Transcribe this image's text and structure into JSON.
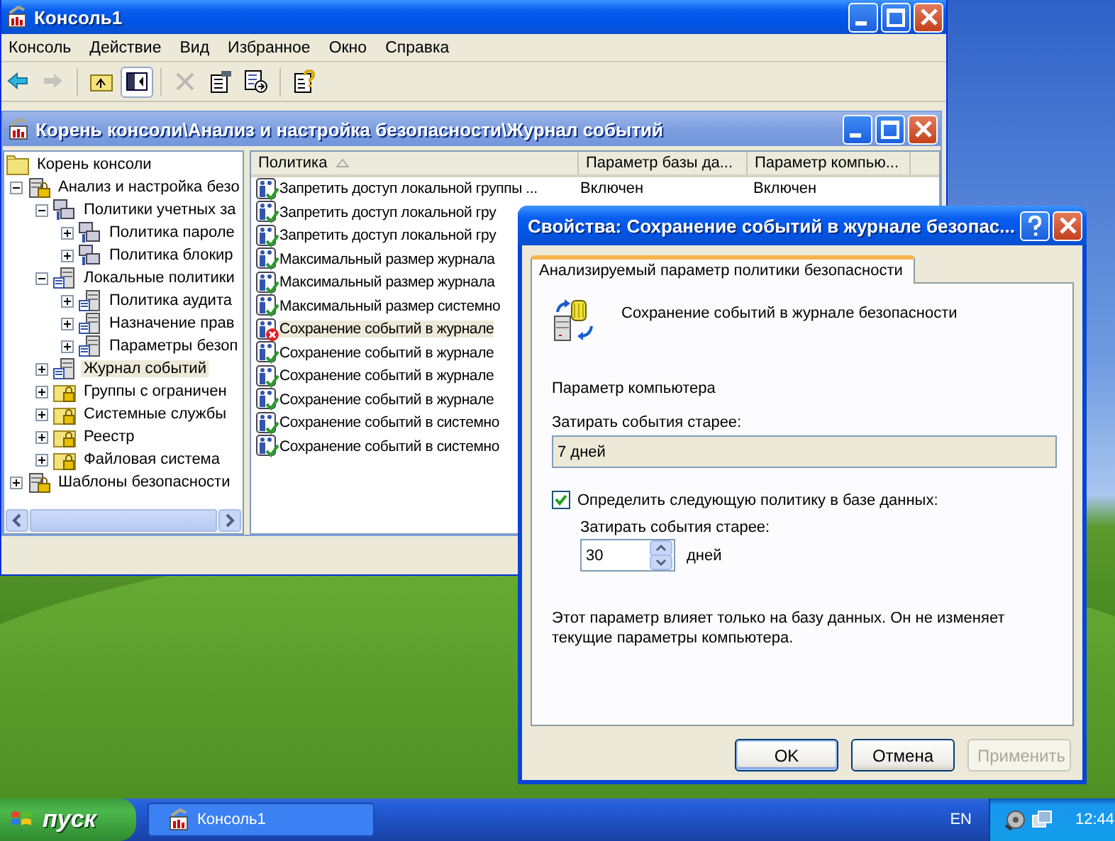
{
  "main_window": {
    "title": "Консоль1",
    "menu": [
      "Консоль",
      "Действие",
      "Вид",
      "Избранное",
      "Окно",
      "Справка"
    ],
    "toolbar": [
      {
        "kind": "back",
        "disabled": false
      },
      {
        "kind": "forward",
        "disabled": true
      },
      {
        "kind": "sep"
      },
      {
        "kind": "up",
        "disabled": false
      },
      {
        "kind": "tree",
        "disabled": false,
        "pressed": true
      },
      {
        "kind": "sep"
      },
      {
        "kind": "delete",
        "disabled": true
      },
      {
        "kind": "properties",
        "disabled": false
      },
      {
        "kind": "export",
        "disabled": false
      },
      {
        "kind": "sep"
      },
      {
        "kind": "help",
        "disabled": false
      }
    ]
  },
  "child_window": {
    "title": "Корень консоли\\Анализ и настройка безопасности\\Журнал событий",
    "tree": [
      {
        "label": "Корень консоли",
        "kind": "folder",
        "selected": false,
        "children": [
          {
            "label": "Анализ и настройка безо",
            "kind": "secure",
            "expanded": true,
            "selected": false,
            "children": [
              {
                "label": "Политики учетных за",
                "kind": "accounts",
                "expanded": true,
                "selected": false,
                "children": [
                  {
                    "label": "Политика пароле",
                    "kind": "accounts",
                    "expanded": false,
                    "selected": false
                  },
                  {
                    "label": "Политика блокир",
                    "kind": "accounts",
                    "expanded": false,
                    "selected": false
                  }
                ]
              },
              {
                "label": "Локальные политики",
                "kind": "local",
                "expanded": true,
                "selected": false,
                "children": [
                  {
                    "label": "Политика аудита",
                    "kind": "local",
                    "expanded": false,
                    "selected": false
                  },
                  {
                    "label": "Назначение прав",
                    "kind": "local",
                    "expanded": false,
                    "selected": false
                  },
                  {
                    "label": "Параметры безоп",
                    "kind": "local",
                    "expanded": false,
                    "selected": false
                  }
                ]
              },
              {
                "label": "Журнал событий",
                "kind": "local",
                "expanded": false,
                "selected": true
              },
              {
                "label": "Группы с ограничен",
                "kind": "lockfolder",
                "expanded": false,
                "selected": false
              },
              {
                "label": "Системные службы",
                "kind": "lockfolder",
                "expanded": false,
                "selected": false
              },
              {
                "label": "Реестр",
                "kind": "lockfolder",
                "expanded": false,
                "selected": false
              },
              {
                "label": "Файловая система",
                "kind": "lockfolder",
                "expanded": false,
                "selected": false
              }
            ]
          },
          {
            "label": "Шаблоны безопасности",
            "kind": "secure",
            "expanded": false,
            "selected": false
          }
        ]
      }
    ],
    "list": {
      "columns": [
        {
          "label": "Политика",
          "sorted": true
        },
        {
          "label": "Параметр базы да...",
          "sorted": false
        },
        {
          "label": "Параметр компью...",
          "sorted": false
        }
      ],
      "rows": [
        {
          "policy": "Запретить доступ локальной группы ...",
          "database": "Включен",
          "computer": "Включен",
          "mismatch": false,
          "selected": false
        },
        {
          "policy": "Запретить доступ локальной гру",
          "mismatch": false,
          "selected": false
        },
        {
          "policy": "Запретить доступ локальной гру",
          "mismatch": false,
          "selected": false
        },
        {
          "policy": "Максимальный размер журнала",
          "mismatch": false,
          "selected": false
        },
        {
          "policy": "Максимальный размер журнала",
          "mismatch": false,
          "selected": false
        },
        {
          "policy": "Максимальный размер системно",
          "mismatch": false,
          "selected": false
        },
        {
          "policy": "Сохранение событий в журнале",
          "mismatch": true,
          "selected": true
        },
        {
          "policy": "Сохранение событий в журнале",
          "mismatch": false,
          "selected": false
        },
        {
          "policy": "Сохранение событий в журнале",
          "mismatch": false,
          "selected": false
        },
        {
          "policy": "Сохранение событий в журнале",
          "mismatch": false,
          "selected": false
        },
        {
          "policy": "Сохранение событий в системно",
          "mismatch": false,
          "selected": false
        },
        {
          "policy": "Сохранение событий в системно",
          "mismatch": false,
          "selected": false
        }
      ]
    }
  },
  "dialog": {
    "title": "Свойства: Сохранение событий в журнале безопас...",
    "tabs": [
      {
        "label": "Анализируемый параметр политики безопасности",
        "selected": true
      }
    ],
    "heading": "Сохранение событий в журнале безопасности",
    "section": "Параметр компьютера",
    "computer_label": "Затирать события старее:",
    "computer_value": "7 дней",
    "checkbox": {
      "label": "Определить следующую политику в базе данных:",
      "checked": true
    },
    "database_label": "Затирать события старее:",
    "spinner": {
      "value": "30"
    },
    "unit": "дней",
    "note": "Этот параметр влияет только на базу данных. Он не изменяет текущие параметры компьютера.",
    "buttons": [
      {
        "label": "OK",
        "default": true,
        "disabled": false
      },
      {
        "label": "Отмена",
        "default": false,
        "disabled": false
      },
      {
        "label": "Применить",
        "default": false,
        "disabled": true
      }
    ]
  },
  "taskbar": {
    "start": "пуск",
    "tasks": [
      {
        "label": "Консоль1",
        "selected": false
      }
    ],
    "language": "EN",
    "clock": "12:44"
  }
}
